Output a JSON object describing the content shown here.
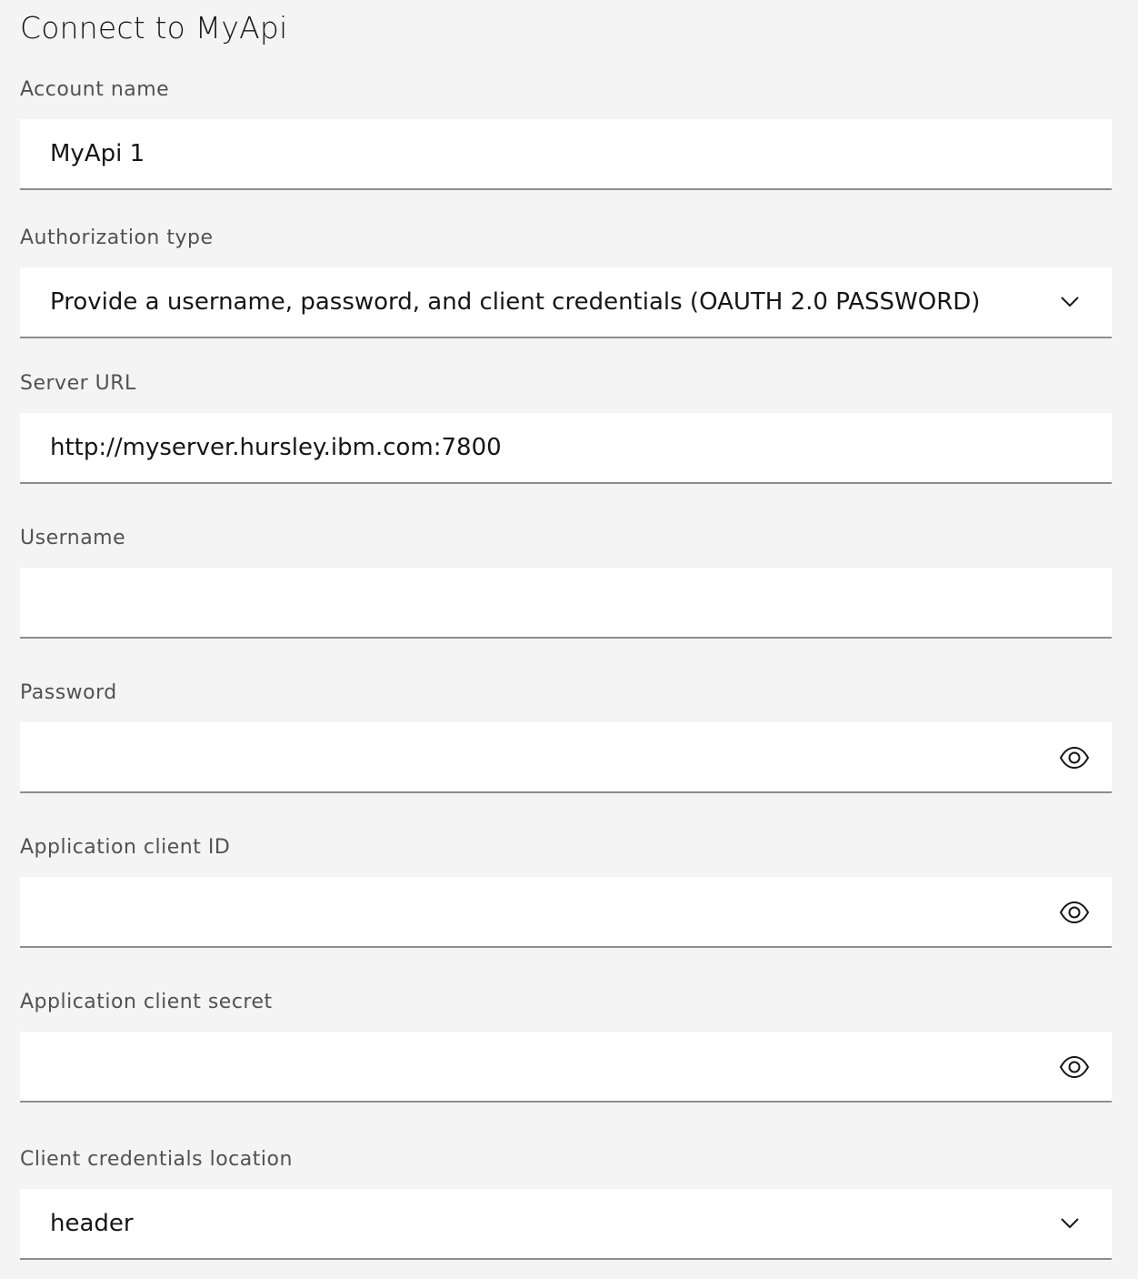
{
  "page": {
    "title": "Connect to MyApi"
  },
  "form": {
    "account_name": {
      "label": "Account name",
      "value": "MyApi 1"
    },
    "authorization_type": {
      "label": "Authorization type",
      "selected": "Provide a username, password, and client credentials (OAUTH 2.0 PASSWORD)",
      "icon": "chevron-down-icon"
    },
    "server_url": {
      "label": "Server URL",
      "value": "http://myserver.hursley.ibm.com:7800"
    },
    "username": {
      "label": "Username",
      "value": ""
    },
    "password": {
      "label": "Password",
      "value": "",
      "icon": "eye-icon"
    },
    "client_id": {
      "label": "Application client ID",
      "value": "",
      "icon": "eye-icon"
    },
    "client_secret": {
      "label": "Application client secret",
      "value": "",
      "icon": "eye-icon"
    },
    "credentials_location": {
      "label": "Client credentials location",
      "selected": "header",
      "icon": "chevron-down-icon"
    }
  },
  "colors": {
    "background": "#f4f4f4",
    "field_background": "#ffffff",
    "field_border": "#8d8d8d",
    "label_text": "#525252",
    "value_text": "#161616"
  }
}
